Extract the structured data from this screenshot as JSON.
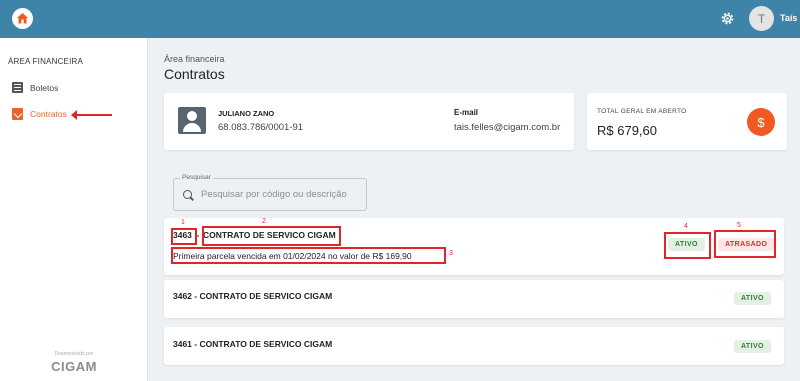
{
  "topbar": {
    "user_initial": "T",
    "user_name": "Taís"
  },
  "sidebar": {
    "section_title": "ÁREA FINANCEIRA",
    "items": [
      {
        "label": "Boletos"
      },
      {
        "label": "Contratos"
      }
    ],
    "footer_developed_by": "Desenvolvido por",
    "footer_brand": "CIGAM"
  },
  "page": {
    "breadcrumb": "Área financeira",
    "title": "Contratos"
  },
  "client": {
    "name": "JULIANO ZANO",
    "document": "68.083.786/0001-91",
    "email_label": "E-mail",
    "email": "tais.felles@cigam.com.br"
  },
  "total": {
    "label": "TOTAL GERAL EM ABERTO",
    "value": "R$ 679,60",
    "icon": "$"
  },
  "search": {
    "label": "Pesquisar",
    "placeholder": "Pesquisar por código ou descrição"
  },
  "contracts": [
    {
      "code": "3463",
      "separator": " - ",
      "title": "CONTRATO DE SERVICO CIGAM",
      "subtitle": "Primeira parcela vencida em 01/02/2024 no valor de R$ 169,90",
      "status": "ATIVO",
      "flag": "ATRASADO"
    },
    {
      "label": "3462 - CONTRATO DE SERVICO CIGAM",
      "status": "ATIVO"
    },
    {
      "label": "3461 - CONTRATO DE SERVICO CIGAM",
      "status": "ATIVO"
    }
  ],
  "annotations": [
    "1",
    "2",
    "3",
    "4",
    "5"
  ],
  "colors": {
    "topbar": "#3d84a8",
    "accent": "#e8642c",
    "annotation": "#e3242b"
  }
}
